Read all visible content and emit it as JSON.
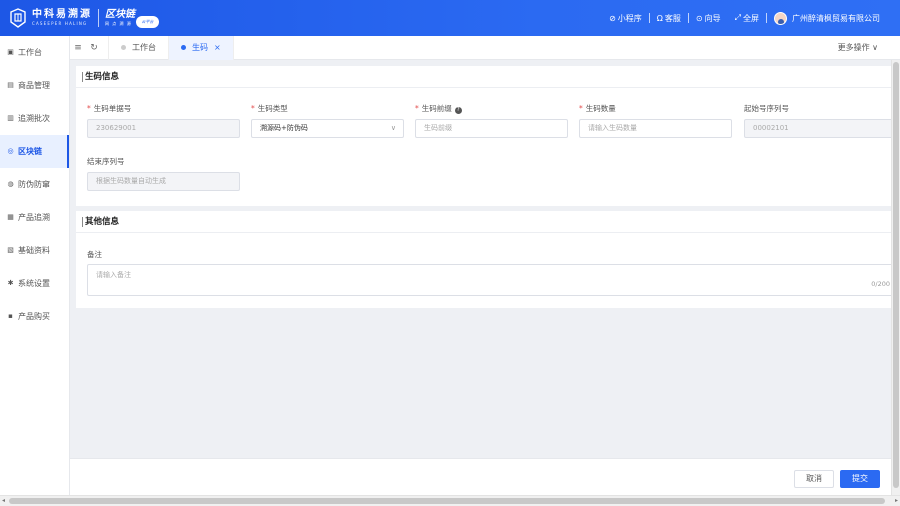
{
  "brand": {
    "name_cn": "中科易溯源",
    "name_en": "CASEEPER HALING",
    "chain_cn": "区块链",
    "chain_sub": "网 点 溯 源",
    "cloud_badge": "云平台"
  },
  "header": {
    "actions": [
      {
        "icon": "mini-program-icon",
        "label": "小程序"
      },
      {
        "icon": "headset-icon",
        "label": "客服"
      },
      {
        "icon": "guide-icon",
        "label": "向导"
      },
      {
        "icon": "fullscreen-icon",
        "label": "全屏"
      }
    ],
    "company": "广州醉清枫贸易有限公司"
  },
  "sidebar": {
    "items": [
      {
        "label": "工作台",
        "icon": "dashboard-icon",
        "active": false
      },
      {
        "label": "商品管理",
        "icon": "goods-icon",
        "active": false
      },
      {
        "label": "追溯批次",
        "icon": "batch-icon",
        "active": false
      },
      {
        "label": "区块链",
        "icon": "blockchain-icon",
        "active": true
      },
      {
        "label": "防伪防窜",
        "icon": "anti-fake-icon",
        "active": false
      },
      {
        "label": "产品追溯",
        "icon": "trace-icon",
        "active": false
      },
      {
        "label": "基础资料",
        "icon": "basic-data-icon",
        "active": false
      },
      {
        "label": "系统设置",
        "icon": "settings-icon",
        "active": false
      },
      {
        "label": "产品购买",
        "icon": "purchase-icon",
        "active": false
      }
    ]
  },
  "tabs": {
    "items": [
      {
        "label": "工作台",
        "active": false
      },
      {
        "label": "生码",
        "active": true,
        "close": "×"
      }
    ],
    "more_ops": "更多操作 ∨"
  },
  "form": {
    "section_title": "生码信息",
    "fields": {
      "order_no": {
        "label": "生码单据号",
        "required": true,
        "value": "230629001"
      },
      "code_type": {
        "label": "生码类型",
        "required": true,
        "value": "溯源码+防伪码"
      },
      "code_prefix": {
        "label": "生码前缀",
        "required": true,
        "placeholder": "生码前缀"
      },
      "code_count": {
        "label": "生码数量",
        "required": true,
        "placeholder": "请输入生码数量"
      },
      "start_serial": {
        "label": "起始号序列号",
        "required": false,
        "value": "00002101"
      },
      "end_serial": {
        "label": "结束序列号",
        "required": false,
        "placeholder": "根据生码数量自动生成"
      }
    }
  },
  "other": {
    "section_title": "其他信息",
    "remark_label": "备注",
    "remark_placeholder": "请输入备注",
    "counter": "0/200"
  },
  "footer": {
    "cancel": "取消",
    "submit": "提交"
  },
  "colors": {
    "brand_blue": "#2b6af2",
    "required_red": "#e34d4d"
  }
}
